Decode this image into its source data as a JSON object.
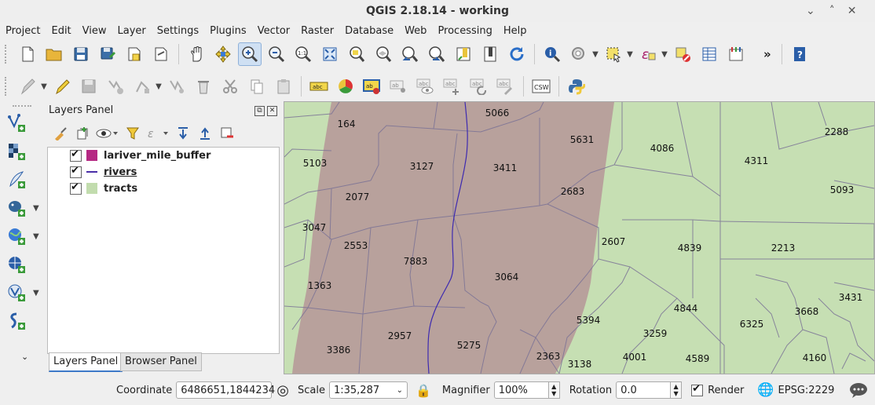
{
  "window": {
    "title": "QGIS 2.18.14 - working",
    "controls": [
      "⌄",
      "˄",
      "✕"
    ]
  },
  "menu": [
    "Project",
    "Edit",
    "View",
    "Layer",
    "Settings",
    "Plugins",
    "Vector",
    "Raster",
    "Database",
    "Web",
    "Processing",
    "Help"
  ],
  "toolbar": {
    "more": "»",
    "csw_label": "CSW"
  },
  "layers_panel": {
    "title": "Layers Panel",
    "layers": [
      {
        "name": "lariver_mile_buffer",
        "color": "#b52883",
        "type": "polygon"
      },
      {
        "name": "rivers",
        "color": "#4a2fa8",
        "type": "line"
      },
      {
        "name": "tracts",
        "color": "#c2dcae",
        "type": "polygon"
      }
    ],
    "tabs": [
      "Layers Panel",
      "Browser Panel"
    ]
  },
  "map": {
    "tract_color": "#c6dfb3",
    "buffer_color": "#b8a19c",
    "river_color": "#3d2ab0",
    "labels": [
      {
        "t": "164"
      },
      {
        "t": "5066"
      },
      {
        "t": "5631"
      },
      {
        "t": "2288"
      },
      {
        "t": "4086"
      },
      {
        "t": "5103"
      },
      {
        "t": "3127"
      },
      {
        "t": "3411"
      },
      {
        "t": "4311"
      },
      {
        "t": "2077"
      },
      {
        "t": "2683"
      },
      {
        "t": "5093"
      },
      {
        "t": "3047"
      },
      {
        "t": "2553"
      },
      {
        "t": "2607"
      },
      {
        "t": "4839"
      },
      {
        "t": "2213"
      },
      {
        "t": "7883"
      },
      {
        "t": "3064"
      },
      {
        "t": "1363"
      },
      {
        "t": "4844"
      },
      {
        "t": "3431"
      },
      {
        "t": "3668"
      },
      {
        "t": "5394"
      },
      {
        "t": "6325"
      },
      {
        "t": "3259"
      },
      {
        "t": "3386"
      },
      {
        "t": "2957"
      },
      {
        "t": "5275"
      },
      {
        "t": "2363"
      },
      {
        "t": "4001"
      },
      {
        "t": "4589"
      },
      {
        "t": "4160"
      },
      {
        "t": "3138"
      }
    ]
  },
  "status": {
    "coordinate_label": "Coordinate",
    "coordinate_value": "6486651,1844234",
    "scale_label": "Scale",
    "scale_value": "1:35,287",
    "magnifier_label": "Magnifier",
    "magnifier_value": "100%",
    "rotation_label": "Rotation",
    "rotation_value": "0.0",
    "render_label": "Render",
    "epsg": "EPSG:2229"
  }
}
